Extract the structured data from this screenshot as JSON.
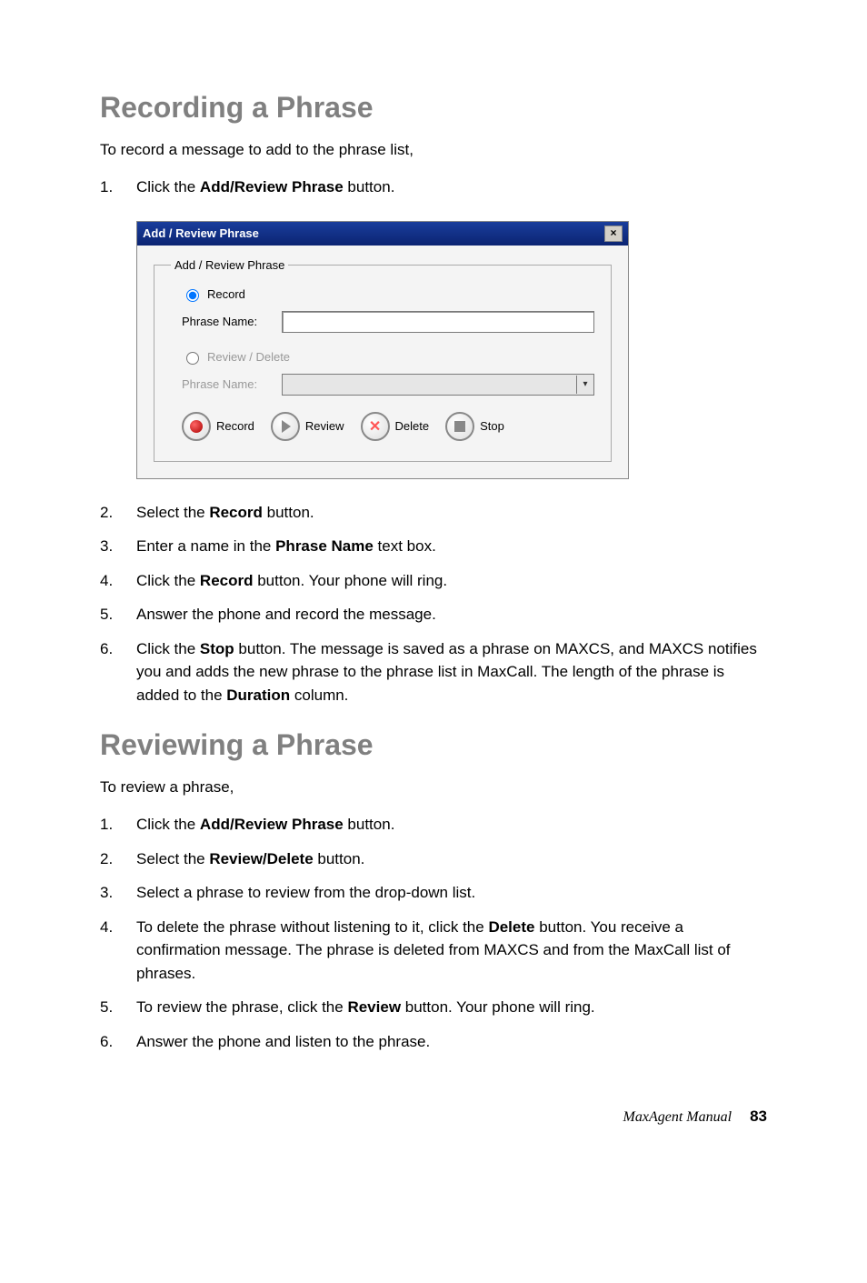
{
  "sections": {
    "recording": {
      "heading": "Recording a Phrase",
      "intro": "To record a message to add to the phrase list,",
      "steps": [
        {
          "num": "1.",
          "html": "Click the <b>Add/Review Phrase</b> button."
        },
        {
          "num": "2.",
          "html": "Select the <b>Record</b> button."
        },
        {
          "num": "3.",
          "html": "Enter a name in the <b>Phrase Name</b> text box."
        },
        {
          "num": "4.",
          "html": "Click the <b>Record</b> button. Your phone will ring."
        },
        {
          "num": "5.",
          "html": "Answer the phone and record the message."
        },
        {
          "num": "6.",
          "html": "Click the <b>Stop</b> button. The message is saved as a phrase on MAXCS, and MAXCS notifies you and adds the new phrase to the phrase list in MaxCall. The length of the phrase is added to the <b>Duration</b> column."
        }
      ]
    },
    "reviewing": {
      "heading": "Reviewing a Phrase",
      "intro": "To review a phrase,",
      "steps": [
        {
          "num": "1.",
          "html": "Click the <b>Add/Review Phrase</b> button."
        },
        {
          "num": "2.",
          "html": "Select the <b>Review/Delete</b> button."
        },
        {
          "num": "3.",
          "html": "Select a phrase to review from the drop-down list."
        },
        {
          "num": "4.",
          "html": "To delete the phrase without listening to it, click the <b>Delete</b> button. You receive a confirmation message. The phrase is deleted from MAXCS and from the MaxCall list of phrases."
        },
        {
          "num": "5.",
          "html": "To review the phrase, click the <b>Review</b> button. Your phone will ring."
        },
        {
          "num": "6.",
          "html": "Answer the phone and listen to the phrase."
        }
      ]
    }
  },
  "dialog": {
    "title": "Add / Review Phrase",
    "close_glyph": "×",
    "legend": "Add / Review Phrase",
    "record_radio_label": "Record",
    "phrase_name_label": "Phrase Name:",
    "review_radio_label": "Review / Delete",
    "phrase_name_label2": "Phrase Name:",
    "buttons": {
      "record": "Record",
      "review": "Review",
      "delete": "Delete",
      "stop": "Stop"
    },
    "dropdown_arrow": "▾"
  },
  "footer": {
    "book": "MaxAgent Manual",
    "page": "83"
  }
}
